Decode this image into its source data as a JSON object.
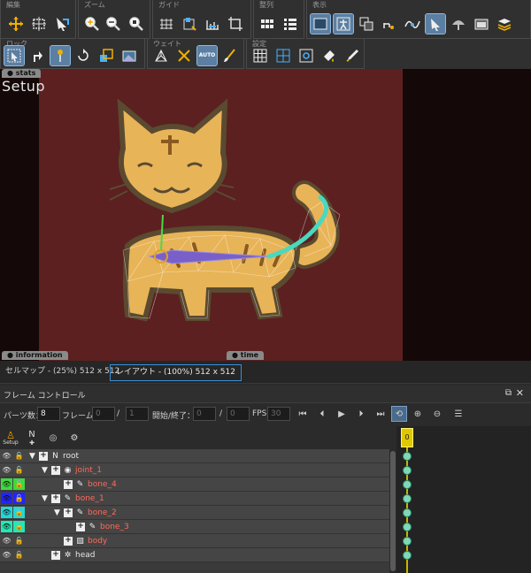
{
  "toolbar1": {
    "groups": [
      {
        "label": "編集"
      },
      {
        "label": "ズーム"
      },
      {
        "label": "ガイド"
      },
      {
        "label": "整列"
      },
      {
        "label": "表示"
      }
    ]
  },
  "toolbar2": {
    "groups": [
      {
        "label": "ロック"
      },
      {
        "label": "ウェイト"
      },
      {
        "label": "設定"
      }
    ],
    "auto_label": "AUTO"
  },
  "canvas": {
    "stats_tab": "stats",
    "mode_label": "Setup",
    "information_tab": "information",
    "time_tab": "time",
    "stage_color": "#5c2020"
  },
  "view_tabs": [
    {
      "label": "セルマップ - (25%) 512 x 512",
      "selected": false
    },
    {
      "label": "レイアウト - (100%) 512 x 512",
      "selected": true
    }
  ],
  "frame_control": {
    "title": "フレーム コントロール",
    "parts_label": "パーツ数：",
    "parts_value": "8",
    "frame_label": "フレーム：",
    "frame_value": "0",
    "frame_sep": "/",
    "frame_total": "1",
    "range_label": "開始/終了：",
    "range_start": "0",
    "range_sep": "/",
    "range_end": "0",
    "fps_label": "FPS",
    "fps_value": "30",
    "setup_caption": "Setup",
    "timeline_frame": "0"
  },
  "tree_rows": [
    {
      "name": "root",
      "indent": 0,
      "expand": "▼",
      "icon": "N",
      "color": "white",
      "tag": null
    },
    {
      "name": "joint_1",
      "indent": 1,
      "expand": "▼",
      "icon": "◉",
      "color": "red",
      "tag": null
    },
    {
      "name": "bone_4",
      "indent": 2,
      "expand": "",
      "icon": "bone",
      "color": "red",
      "tag": "#3fd93f"
    },
    {
      "name": "bone_1",
      "indent": 1,
      "expand": "▼",
      "icon": "bone",
      "color": "red",
      "tag": "#2424ff"
    },
    {
      "name": "bone_2",
      "indent": 2,
      "expand": "▼",
      "icon": "bone",
      "color": "red",
      "tag": "#22d8d8"
    },
    {
      "name": "bone_3",
      "indent": 3,
      "expand": "",
      "icon": "bone",
      "color": "red",
      "tag": "#22e8b4"
    },
    {
      "name": "body",
      "indent": 2,
      "expand": "",
      "icon": "mesh",
      "color": "red",
      "tag": null
    },
    {
      "name": "head",
      "indent": 1,
      "expand": "",
      "icon": "cell",
      "color": "white",
      "tag": null
    }
  ]
}
